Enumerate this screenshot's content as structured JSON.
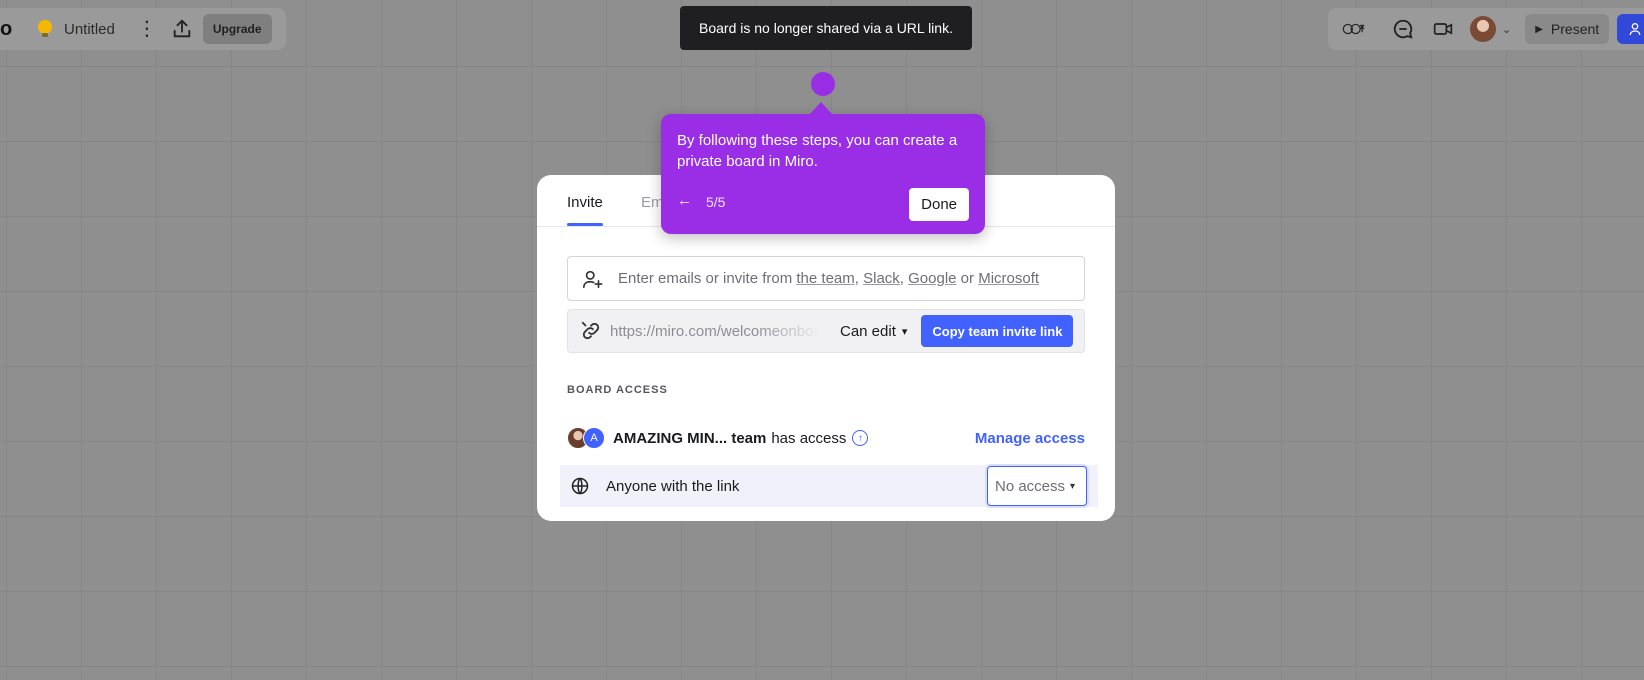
{
  "topbar": {
    "logo": "o",
    "board_title": "Untitled",
    "more_label": "⋮",
    "upgrade_label": "Upgrade"
  },
  "toast": {
    "message": "Board is no longer shared via a URL link."
  },
  "topright": {
    "present_label": "Present",
    "share_icon": "user-plus-icon"
  },
  "tooltip": {
    "text": "By following these steps, you can create a private board in Miro.",
    "back_arrow": "←",
    "step": "5/5",
    "done_label": "Done"
  },
  "modal": {
    "tabs": [
      {
        "label": "Invite",
        "active": true
      },
      {
        "label": "Em",
        "active": false
      }
    ],
    "email": {
      "prefix": "Enter emails or invite from ",
      "team": "the team",
      "sep1": ", ",
      "slack": "Slack",
      "sep2": ", ",
      "google": "Google",
      "sep3": " or ",
      "microsoft": "Microsoft"
    },
    "link": {
      "url": "https://miro.com/welcomeonboard",
      "permission": "Can edit",
      "copy_label": "Copy team invite link"
    },
    "board_access_label": "BOARD ACCESS",
    "team": {
      "avatar_letter": "A",
      "name": "AMAZING MIN... team",
      "suffix": "has access",
      "manage_label": "Manage access"
    },
    "anyone": {
      "label": "Anyone with the link",
      "access": "No access"
    }
  },
  "colors": {
    "accent": "#4262ff",
    "tooltip": "#9a2ee6",
    "toast": "#1f1f21",
    "overlay": "#8f8f8f"
  }
}
